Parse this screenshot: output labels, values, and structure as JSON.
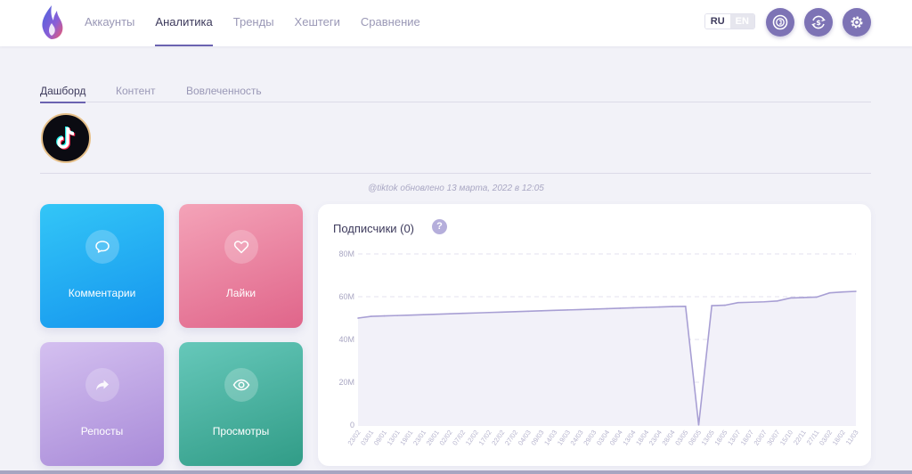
{
  "header": {
    "nav": [
      {
        "label": "Аккаунты",
        "active": false
      },
      {
        "label": "Аналитика",
        "active": true
      },
      {
        "label": "Тренды",
        "active": false
      },
      {
        "label": "Хештеги",
        "active": false
      },
      {
        "label": "Сравнение",
        "active": false
      }
    ],
    "lang": {
      "ru": "RU",
      "en": "EN",
      "selected": "RU"
    },
    "icons": [
      "coin-icon",
      "currency-exchange-icon",
      "gear-icon"
    ]
  },
  "tabs": [
    {
      "label": "Дашборд",
      "active": true
    },
    {
      "label": "Контент",
      "active": false
    },
    {
      "label": "Вовлеченность",
      "active": false
    }
  ],
  "profile": {
    "icon": "tiktok-logo"
  },
  "updated_text": "@tiktok обновлено 13 марта, 2022 в 12:05",
  "cards": {
    "comments": {
      "label": "Комментарии",
      "icon": "speech-bubble-icon"
    },
    "likes": {
      "label": "Лайки",
      "icon": "heart-icon"
    },
    "reposts": {
      "label": "Репосты",
      "icon": "share-arrow-icon"
    },
    "views": {
      "label": "Просмотры",
      "icon": "eye-icon"
    }
  },
  "panel": {
    "title": "Подписчики (0)",
    "help": "?"
  },
  "colors": {
    "accent": "#6b63b0",
    "line": "#a89fd4",
    "comments": "#1fa9f2",
    "likes": "#e87898",
    "reposts": "#b99ee3",
    "views": "#45ae9e"
  },
  "chart_data": {
    "type": "line",
    "yticks": [
      "0",
      "20M",
      "40M",
      "60M",
      "80M"
    ],
    "ylim": [
      0,
      80000000
    ],
    "categories": [
      "23/02",
      "03/01",
      "09/01",
      "13/01",
      "19/01",
      "23/01",
      "28/01",
      "02/02",
      "07/02",
      "12/02",
      "17/02",
      "22/02",
      "27/02",
      "04/03",
      "09/03",
      "14/03",
      "19/03",
      "24/03",
      "29/03",
      "03/04",
      "08/04",
      "13/04",
      "18/04",
      "23/04",
      "28/04",
      "03/05",
      "08/05",
      "13/05",
      "18/05",
      "13/07",
      "18/07",
      "20/07",
      "30/07",
      "15/10",
      "22/11",
      "27/11",
      "03/02",
      "18/02",
      "11/03"
    ],
    "series": [
      {
        "values": [
          50000000,
          50800000,
          51000000,
          51200000,
          51400000,
          51600000,
          51800000,
          52000000,
          52200000,
          52400000,
          52600000,
          52800000,
          53000000,
          53200000,
          53400000,
          53600000,
          53800000,
          54000000,
          54200000,
          54400000,
          54600000,
          54800000,
          55000000,
          55200000,
          55400000,
          55500000,
          0,
          55800000,
          56000000,
          57200000,
          57400000,
          57600000,
          58000000,
          59400000,
          59600000,
          59800000,
          61800000,
          62200000,
          62500000
        ]
      }
    ],
    "grid": true
  }
}
